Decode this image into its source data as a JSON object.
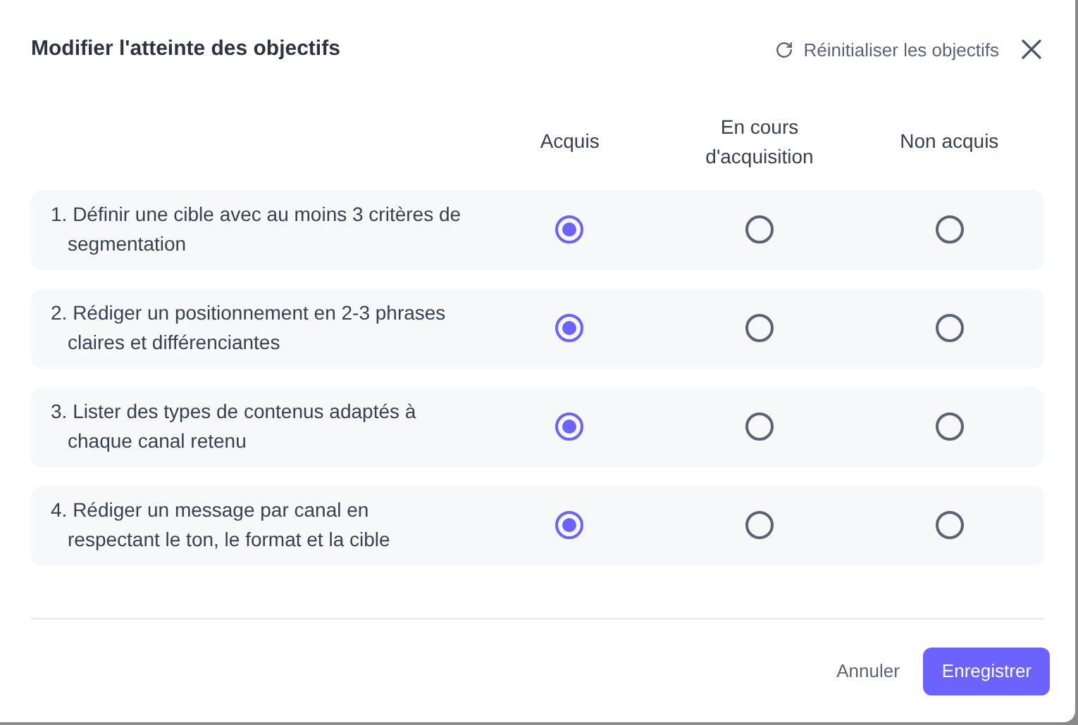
{
  "dialog": {
    "title": "Modifier l'atteinte des objectifs",
    "reset_label": "Réinitialiser les objectifs"
  },
  "columns": [
    "Acquis",
    "En cours d'acquisition",
    "Non acquis"
  ],
  "rows": [
    {
      "text": "1. Définir une cible avec au moins 3 critères de segmentation",
      "options": [
        {
          "selected": true
        },
        {
          "selected": false
        },
        {
          "selected": false
        }
      ]
    },
    {
      "text": "2. Rédiger un positionnement en 2-3 phrases claires et différenciantes",
      "options": [
        {
          "selected": true
        },
        {
          "selected": false
        },
        {
          "selected": false
        }
      ]
    },
    {
      "text": "3. Lister des types de contenus adaptés à chaque canal retenu",
      "options": [
        {
          "selected": true
        },
        {
          "selected": false
        },
        {
          "selected": false
        }
      ]
    },
    {
      "text": "4. Rédiger un message par canal en respectant le ton, le format et la cible",
      "options": [
        {
          "selected": true
        },
        {
          "selected": false
        },
        {
          "selected": false
        }
      ]
    }
  ],
  "footer": {
    "cancel": "Annuler",
    "save": "Enregistrer"
  }
}
